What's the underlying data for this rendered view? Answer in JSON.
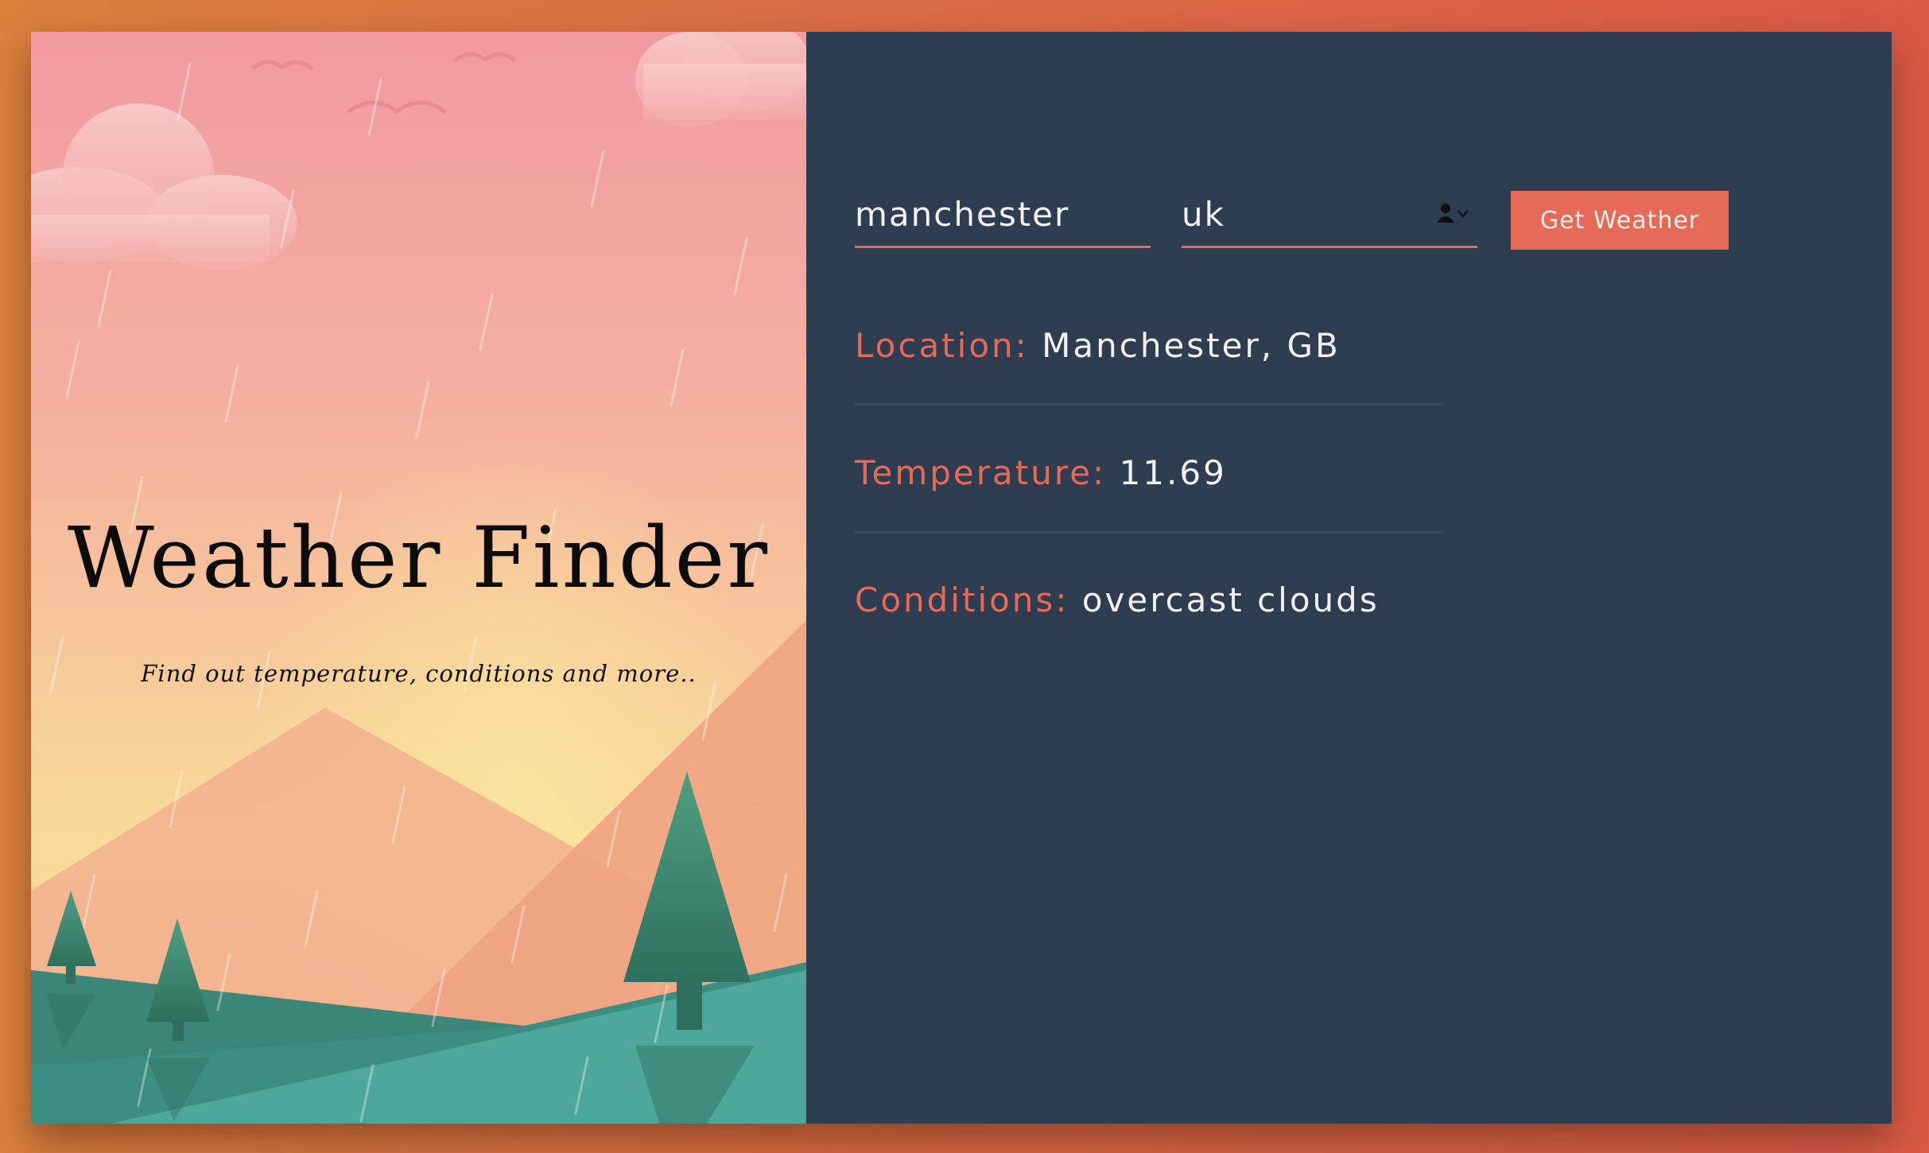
{
  "app": {
    "title": "Weather Finder",
    "subtitle": "Find out temperature, conditions and more.."
  },
  "form": {
    "city_value": "manchester",
    "country_value": "uk",
    "autofill_icon": "contact-autofill-icon",
    "button_label": "Get Weather"
  },
  "results": {
    "location_label": "Location:",
    "location_value": "Manchester, GB",
    "temperature_label": "Temperature:",
    "temperature_value": "11.69",
    "conditions_label": "Conditions:",
    "conditions_value": "overcast clouds"
  },
  "colors": {
    "accent": "#e56a58",
    "panel_bg": "#2e3d4f",
    "page_bg_start": "#d9803d",
    "page_bg_end": "#da5a47"
  }
}
